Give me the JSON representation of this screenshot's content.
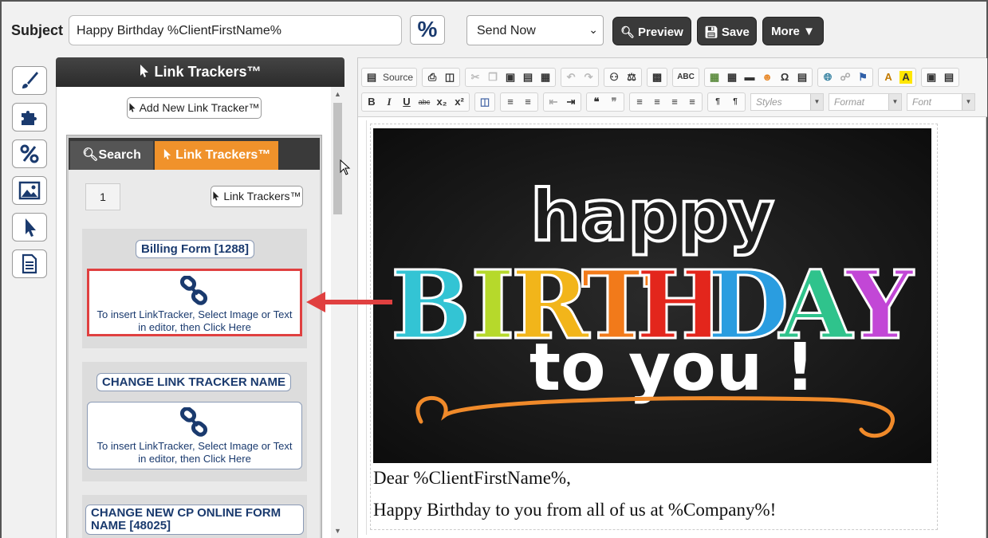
{
  "header": {
    "subject_label": "Subject",
    "subject_value": "Happy Birthday %ClientFirstName%",
    "percent_label": "%",
    "send_option": "Send Now",
    "preview_label": "Preview",
    "save_label": "Save",
    "more_label": "More"
  },
  "sidebar_icons": [
    "brush-icon",
    "puzzle-icon",
    "percent-icon",
    "image-icon",
    "pointer-icon",
    "document-icon"
  ],
  "panel": {
    "title": "Link Trackers™",
    "add_button": "Add New Link Tracker™",
    "tabs": {
      "search": "Search",
      "link_trackers": "Link Trackers™"
    },
    "page_number": "1",
    "lt_button": "Link Trackers™",
    "cards": [
      {
        "title": "Billing Form [1288]",
        "line1": "To insert LinkTracker, Select Image or Text",
        "line2": "in editor, then Click Here"
      },
      {
        "title": "CHANGE LINK TRACKER NAME",
        "line1": "To insert LinkTracker, Select Image or Text",
        "line2": "in editor, then Click Here"
      },
      {
        "title": "CHANGE NEW CP ONLINE FORM NAME [48025]"
      }
    ]
  },
  "editor": {
    "source_label": "Source",
    "styles_placeholder": "Styles",
    "format_placeholder": "Format",
    "font_placeholder": "Font",
    "hero": {
      "line1": "happy",
      "line2": "BIRTHDAY",
      "line3": "to you !"
    },
    "para1": "Dear %ClientFirstName%,",
    "para2": "Happy Birthday to you from all of us at %Company%!"
  }
}
